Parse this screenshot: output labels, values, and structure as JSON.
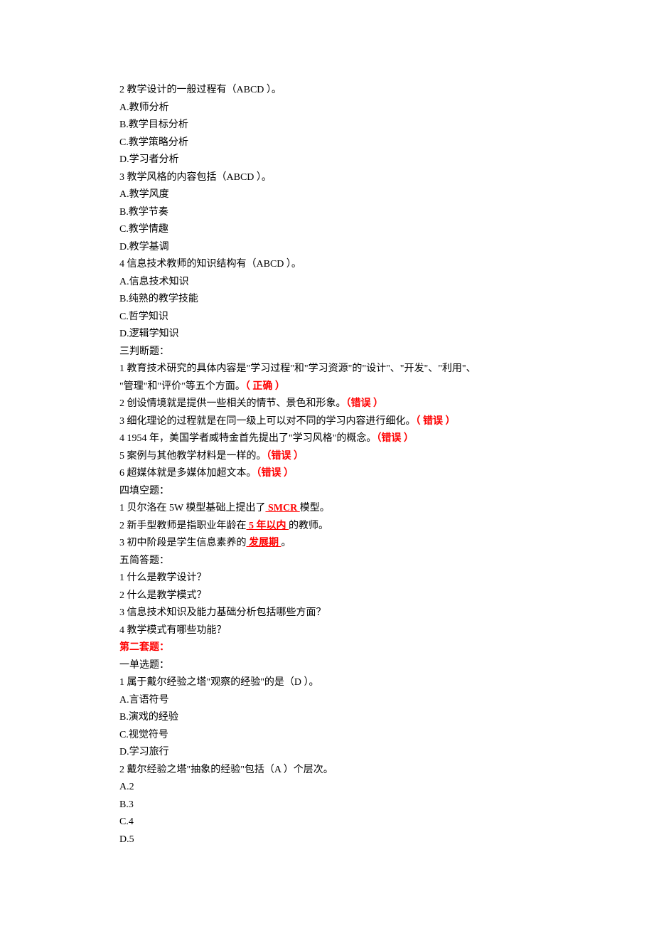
{
  "lines": [
    {
      "segments": [
        {
          "text": "2 教学设计的一般过程有（ABCD ）。"
        }
      ]
    },
    {
      "segments": [
        {
          "text": "A.教师分析"
        }
      ]
    },
    {
      "segments": [
        {
          "text": "B.教学目标分析"
        }
      ]
    },
    {
      "segments": [
        {
          "text": "C.教学策略分析"
        }
      ]
    },
    {
      "segments": [
        {
          "text": "D.学习者分析"
        }
      ]
    },
    {
      "segments": [
        {
          "text": "3 教学风格的内容包括（ABCD ）。"
        }
      ]
    },
    {
      "segments": [
        {
          "text": "A.教学风度"
        }
      ]
    },
    {
      "segments": [
        {
          "text": "B.教学节奏"
        }
      ]
    },
    {
      "segments": [
        {
          "text": "C.教学情趣"
        }
      ]
    },
    {
      "segments": [
        {
          "text": "D.教学基调"
        }
      ]
    },
    {
      "segments": [
        {
          "text": "4 信息技术教师的知识结构有（ABCD ）。"
        }
      ]
    },
    {
      "segments": [
        {
          "text": "A.信息技术知识"
        }
      ]
    },
    {
      "segments": [
        {
          "text": "B.纯熟的教学技能"
        }
      ]
    },
    {
      "segments": [
        {
          "text": "C.哲学知识"
        }
      ]
    },
    {
      "segments": [
        {
          "text": "D.逻辑学知识"
        }
      ]
    },
    {
      "segments": [
        {
          "text": "三判断题："
        }
      ]
    },
    {
      "segments": [
        {
          "text": "1 教育技术研究的具体内容是\"学习过程\"和\"学习资源\"的\"设计\"、\"开发\"、\"利用\"、"
        }
      ]
    },
    {
      "segments": [
        {
          "text": "\"管理\"和\"评价\"等五个方面。"
        },
        {
          "text": "（  正确  ）",
          "red": true
        }
      ]
    },
    {
      "segments": [
        {
          "text": "2 创设情境就是提供一些相关的情节、景色和形象。"
        },
        {
          "text": "（错误   ）",
          "red": true
        }
      ]
    },
    {
      "segments": [
        {
          "text": "3 细化理论的过程就是在同一级上可以对不同的学习内容进行细化。"
        },
        {
          "text": "（  错误  ）",
          "red": true
        }
      ]
    },
    {
      "segments": [
        {
          "text": "4 1954 年，美国学者威特金首先提出了\"学习风格\"的概念。"
        },
        {
          "text": "（错误   ）",
          "red": true
        }
      ]
    },
    {
      "segments": [
        {
          "text": "5 案例与其他教学材料是一样的。"
        },
        {
          "text": "（错误   ）",
          "red": true
        }
      ]
    },
    {
      "segments": [
        {
          "text": "6 超媒体就是多媒体加超文本。"
        },
        {
          "text": "（错误   ）",
          "red": true
        }
      ]
    },
    {
      "segments": [
        {
          "text": "四填空题："
        }
      ]
    },
    {
      "segments": [
        {
          "text": "1 贝尔洛在 5W 模型基础上提出了"
        },
        {
          "text": "   SMCR        ",
          "red": true,
          "underline": true
        },
        {
          "text": "模型。"
        }
      ]
    },
    {
      "segments": [
        {
          "text": "2 新手型教师是指职业年龄在"
        },
        {
          "text": "   5 年以内        ",
          "red": true,
          "underline": true
        },
        {
          "text": "的教师。"
        }
      ]
    },
    {
      "segments": [
        {
          "text": "3 初中阶段是学生信息素养的"
        },
        {
          "text": "   发展期         ",
          "red": true,
          "underline": true
        },
        {
          "text": "。"
        }
      ]
    },
    {
      "segments": [
        {
          "text": "五简答题："
        }
      ]
    },
    {
      "segments": [
        {
          "text": "1 什么是教学设计？"
        }
      ]
    },
    {
      "segments": [
        {
          "text": "2 什么是教学模式？"
        }
      ]
    },
    {
      "segments": [
        {
          "text": "3 信息技术知识及能力基础分析包括哪些方面？"
        }
      ]
    },
    {
      "segments": [
        {
          "text": "4 教学模式有哪些功能？"
        }
      ]
    },
    {
      "segments": [
        {
          "text": "第二套题：",
          "red": true
        }
      ]
    },
    {
      "segments": [
        {
          "text": "一单选题："
        }
      ]
    },
    {
      "segments": [
        {
          "text": "1 属于戴尔经验之塔\"观察的经验\"的是（D ）。"
        }
      ]
    },
    {
      "segments": [
        {
          "text": "A.言语符号"
        }
      ]
    },
    {
      "segments": [
        {
          "text": "B.演戏的经验"
        }
      ]
    },
    {
      "segments": [
        {
          "text": "C.视觉符号"
        }
      ]
    },
    {
      "segments": [
        {
          "text": "D.学习旅行"
        }
      ]
    },
    {
      "segments": [
        {
          "text": "2 戴尔经验之塔\"抽象的经验\"包括（A ）个层次。"
        }
      ]
    },
    {
      "segments": [
        {
          "text": "A.2"
        }
      ]
    },
    {
      "segments": [
        {
          "text": "B.3"
        }
      ]
    },
    {
      "segments": [
        {
          "text": "C.4"
        }
      ]
    },
    {
      "segments": [
        {
          "text": "D.5"
        }
      ]
    }
  ]
}
